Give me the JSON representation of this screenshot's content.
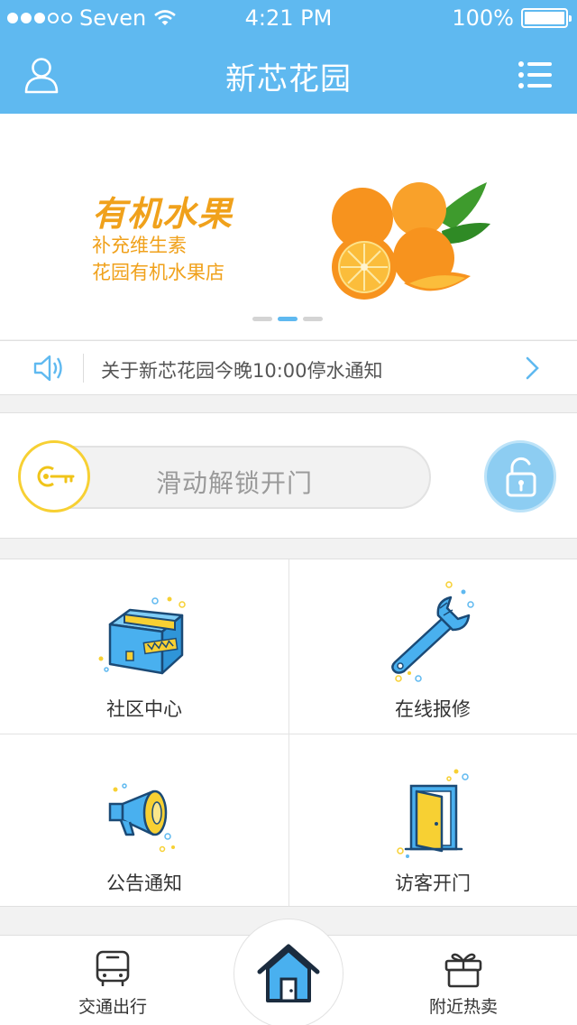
{
  "status_bar": {
    "carrier": "Seven",
    "time": "4:21 PM",
    "battery": "100%",
    "signal_bars_filled": 3,
    "signal_bars_total": 5
  },
  "nav": {
    "title": "新芯花园",
    "left_icon": "user-icon",
    "right_icon": "menu-list-icon"
  },
  "banner": {
    "headline": "有机水果",
    "line1": "补充维生素",
    "line2": "花园有机水果店",
    "image": "oranges-illustration",
    "pages": 3,
    "active_page": 2
  },
  "notice": {
    "icon": "speaker-icon",
    "text": "关于新芯花园今晚10:00停水通知",
    "arrow_icon": "chevron-right-icon"
  },
  "unlock": {
    "label": "滑动解锁开门",
    "knob_icon": "key-icon",
    "button_icon": "lock-icon"
  },
  "grid": [
    {
      "label": "社区中心",
      "icon": "package-box-icon"
    },
    {
      "label": "在线报修",
      "icon": "wrench-icon"
    },
    {
      "label": "公告通知",
      "icon": "megaphone-icon"
    },
    {
      "label": "访客开门",
      "icon": "door-icon"
    }
  ],
  "tabbar": {
    "left": {
      "label": "交通出行",
      "icon": "bus-icon"
    },
    "center": {
      "icon": "home-icon"
    },
    "right": {
      "label": "附近热卖",
      "icon": "gift-icon"
    }
  },
  "colors": {
    "primary": "#5fb9f0",
    "accent_orange": "#f0a11b",
    "accent_yellow": "#f7d033"
  }
}
